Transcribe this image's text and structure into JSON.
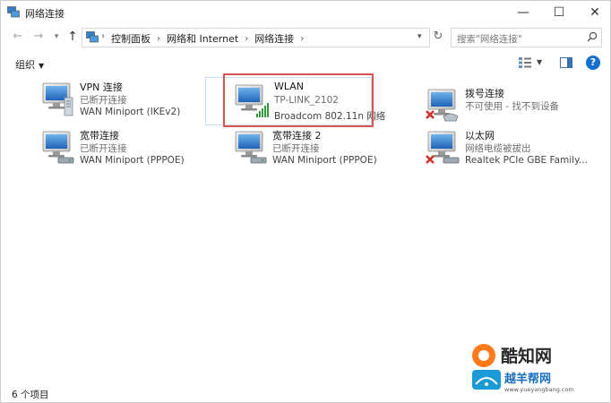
{
  "window": {
    "title": "网络连接",
    "controls": {
      "minimize": "—",
      "maximize": "☐",
      "close": "✕"
    }
  },
  "address_bar": {
    "breadcrumbs": [
      "控制面板",
      "网络和 Internet",
      "网络连接"
    ],
    "separator": "›"
  },
  "search": {
    "placeholder": "搜索\"网络连接\""
  },
  "command_bar": {
    "organize_label": "组织"
  },
  "connections": [
    {
      "name": "VPN 连接",
      "status": "已断开连接",
      "device": "WAN Miniport (IKEv2)",
      "icon": "vpn-connection-icon"
    },
    {
      "name": "WLAN",
      "status": "TP-LINK_2102",
      "device": "Broadcom 802.11n 网络",
      "icon": "wlan-connection-icon"
    },
    {
      "name": "拨号连接",
      "status": "不可使用 - 找不到设备",
      "device": "",
      "icon": "dialup-connection-icon"
    },
    {
      "name": "宽带连接",
      "status": "已断开连接",
      "device": "WAN Miniport (PPPOE)",
      "icon": "broadband-connection-icon"
    },
    {
      "name": "宽带连接 2",
      "status": "已断开连接",
      "device": "WAN Miniport (PPPOE)",
      "icon": "broadband-connection-icon"
    },
    {
      "name": "以太网",
      "status": "网络电缆被拔出",
      "device": "Realtek PCIe GBE Family...",
      "icon": "ethernet-connection-icon"
    }
  ],
  "status_bar": {
    "item_count": "6 个项目"
  },
  "watermark": {
    "brand": "酷知网",
    "site_name": "越羊帮网",
    "site_url": "www.yueyangbang.com"
  },
  "colors": {
    "highlight_border": "#d9534f",
    "help_blue": "#1470cc",
    "monitor_blue": "#2f7fd0",
    "error_red": "#d0312d",
    "signal_green": "#2e9b3a"
  }
}
